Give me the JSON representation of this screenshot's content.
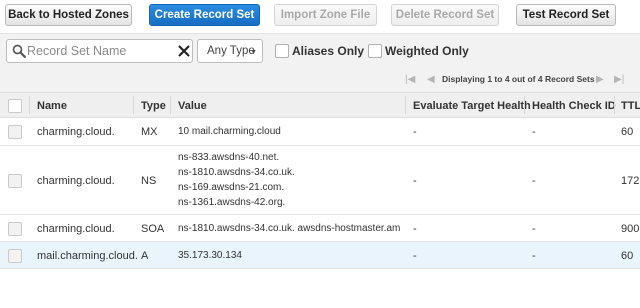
{
  "toolbar": {
    "back_label": "Back to Hosted Zones",
    "create_label": "Create Record Set",
    "import_label": "Import Zone File",
    "delete_label": "Delete Record Set",
    "test_label": "Test Record Set"
  },
  "filter": {
    "search_placeholder": "Record Set Name",
    "type_selected": "Any Type",
    "aliases_only_label": "Aliases Only",
    "weighted_only_label": "Weighted Only"
  },
  "pagination": {
    "summary": "Displaying 1 to 4 out of 4 Record Sets"
  },
  "table": {
    "columns": [
      "Name",
      "Type",
      "Value",
      "Evaluate Target Health",
      "Health Check ID",
      "TTL"
    ],
    "rows": [
      {
        "name": "charming.cloud.",
        "type": "MX",
        "values": [
          "10  mail.charming.cloud"
        ],
        "eval": "-",
        "hc": "-",
        "ttl": "60"
      },
      {
        "name": "charming.cloud.",
        "type": "NS",
        "values": [
          "ns-833.awsdns-40.net.",
          "ns-1810.awsdns-34.co.uk.",
          "ns-169.awsdns-21.com.",
          "ns-1361.awsdns-42.org."
        ],
        "eval": "-",
        "hc": "-",
        "ttl": "172"
      },
      {
        "name": "charming.cloud.",
        "type": "SOA",
        "values": [
          "ns-1810.awsdns-34.co.uk. awsdns-hostmaster.amaz"
        ],
        "eval": "-",
        "hc": "-",
        "ttl": "900"
      },
      {
        "name": "mail.charming.cloud.",
        "type": "A",
        "values": [
          "35.173.30.134"
        ],
        "eval": "-",
        "hc": "-",
        "ttl": "60"
      }
    ]
  }
}
